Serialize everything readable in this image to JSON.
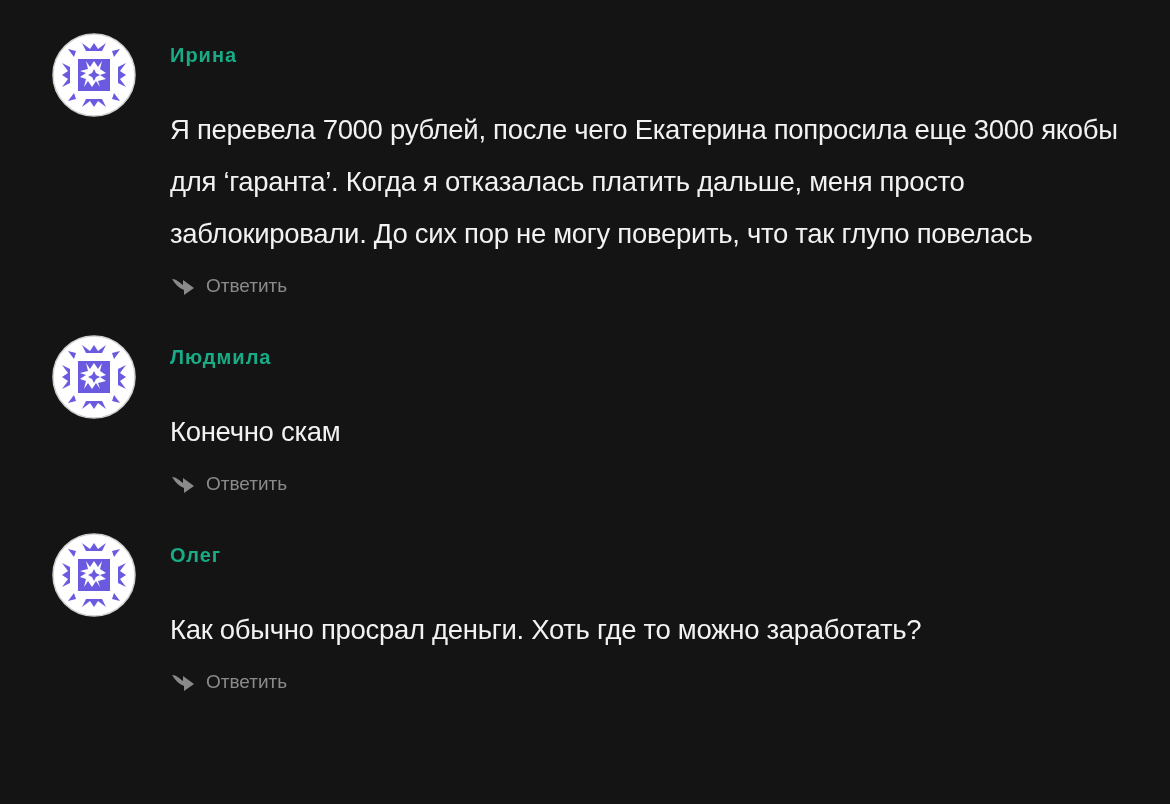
{
  "comments": [
    {
      "author": "Ирина",
      "text": "Я перевела 7000 рублей, после чего Екатерина попросила еще 3000 якобы для ‘гаранта’. Когда я отказалась платить дальше, меня просто заблокировали. До сих пор не могу поверить, что так глупо повелась",
      "reply": "Ответить"
    },
    {
      "author": "Людмила",
      "text": "Конечно скам",
      "reply": "Ответить"
    },
    {
      "author": "Олег",
      "text": "Как обычно просрал деньги. Хоть где то можно заработать?",
      "reply": "Ответить"
    }
  ]
}
